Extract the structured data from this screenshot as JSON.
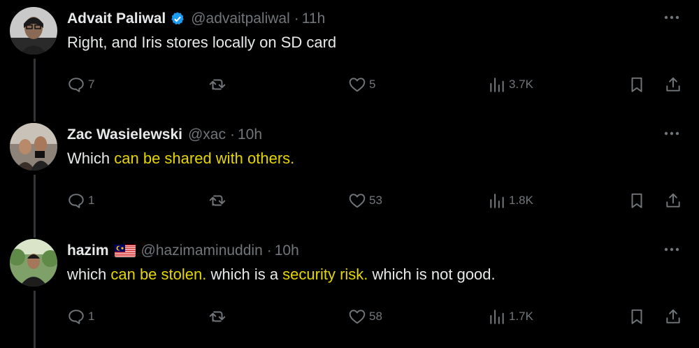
{
  "colors": {
    "background": "#000000",
    "text": "#e7e9ea",
    "muted": "#71767b",
    "highlight": "#e6d600",
    "verified": "#1d9bf0"
  },
  "tweets": [
    {
      "name": "Advait Paliwal",
      "handle": "@advaitpaliwal",
      "dot": "·",
      "time": "11h",
      "badge": "verified-badge-icon",
      "text": [
        {
          "t": "Right, and Iris stores locally on SD card",
          "hl": false
        }
      ],
      "replies": "7",
      "retweets": "",
      "likes": "5",
      "views": "3.7K"
    },
    {
      "name": "Zac Wasielewski",
      "handle": "@xac",
      "dot": "·",
      "time": "10h",
      "badge": "",
      "text": [
        {
          "t": "Which ",
          "hl": false
        },
        {
          "t": "can be shared with others.",
          "hl": true
        }
      ],
      "replies": "1",
      "retweets": "",
      "likes": "53",
      "views": "1.8K"
    },
    {
      "name": "hazim",
      "handle": "@hazimaminuddin",
      "dot": "·",
      "time": "10h",
      "badge": "malaysia-flag-icon",
      "text": [
        {
          "t": "which ",
          "hl": false
        },
        {
          "t": "can be stolen.",
          "hl": true
        },
        {
          "t": " which is a ",
          "hl": false
        },
        {
          "t": "security risk.",
          "hl": true
        },
        {
          "t": " which is not good.",
          "hl": false
        }
      ],
      "replies": "1",
      "retweets": "",
      "likes": "58",
      "views": "1.7K"
    }
  ]
}
